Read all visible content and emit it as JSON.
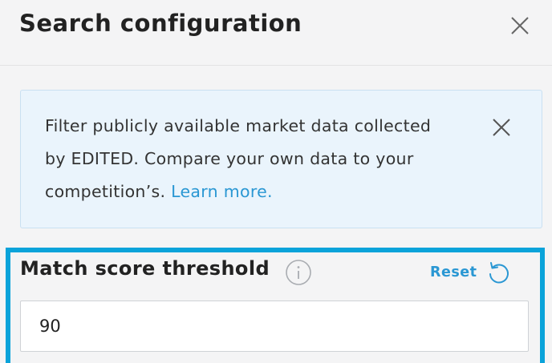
{
  "dialog": {
    "title": "Search configuration"
  },
  "banner": {
    "text": "Filter publicly available market data collected by EDITED. Compare your own data to your competition’s. ",
    "link_label": "Learn more."
  },
  "match_score": {
    "label": "Match score threshold",
    "reset_label": "Reset",
    "value": "90"
  },
  "icons": {
    "close": "close-icon",
    "banner_close": "close-icon",
    "info": "info-icon",
    "reset": "reset-icon"
  },
  "colors": {
    "accent": "#2a97d3",
    "focus_border": "#0aa3da",
    "banner_bg": "#eaf4fc",
    "background": "#f4f4f5"
  }
}
